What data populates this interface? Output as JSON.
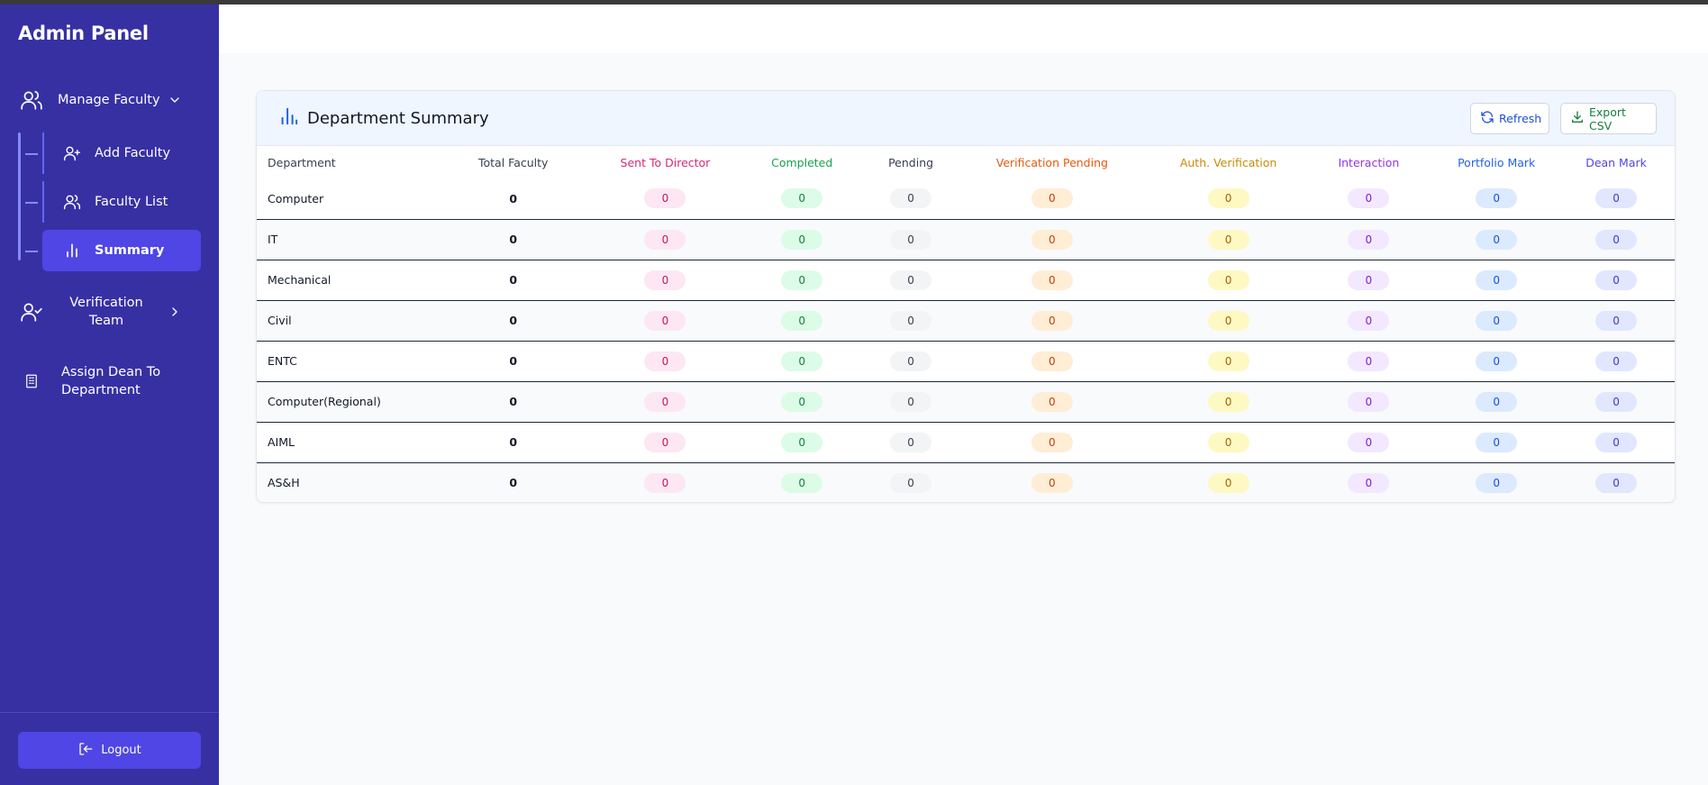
{
  "sidebar": {
    "brand": "Admin Panel",
    "manage_faculty": "Manage Faculty",
    "sub_items": [
      {
        "label": "Add Faculty"
      },
      {
        "label": "Faculty List"
      },
      {
        "label": "Summary"
      }
    ],
    "verification_team": "Verification Team",
    "assign_dean": "Assign Dean To Department",
    "logout": "Logout"
  },
  "summary": {
    "title": "Department Summary",
    "refresh_label": "Refresh",
    "export_label": "Export CSV",
    "columns": [
      "Department",
      "Total Faculty",
      "Sent To Director",
      "Completed",
      "Pending",
      "Verification Pending",
      "Auth. Verification",
      "Interaction",
      "Portfolio Mark",
      "Dean Mark"
    ],
    "rows": [
      {
        "department": "Computer",
        "total": "0",
        "sent": "0",
        "completed": "0",
        "pending": "0",
        "ver_pending": "0",
        "auth": "0",
        "interaction": "0",
        "portfolio": "0",
        "dean": "0"
      },
      {
        "department": "IT",
        "total": "0",
        "sent": "0",
        "completed": "0",
        "pending": "0",
        "ver_pending": "0",
        "auth": "0",
        "interaction": "0",
        "portfolio": "0",
        "dean": "0"
      },
      {
        "department": "Mechanical",
        "total": "0",
        "sent": "0",
        "completed": "0",
        "pending": "0",
        "ver_pending": "0",
        "auth": "0",
        "interaction": "0",
        "portfolio": "0",
        "dean": "0"
      },
      {
        "department": "Civil",
        "total": "0",
        "sent": "0",
        "completed": "0",
        "pending": "0",
        "ver_pending": "0",
        "auth": "0",
        "interaction": "0",
        "portfolio": "0",
        "dean": "0"
      },
      {
        "department": "ENTC",
        "total": "0",
        "sent": "0",
        "completed": "0",
        "pending": "0",
        "ver_pending": "0",
        "auth": "0",
        "interaction": "0",
        "portfolio": "0",
        "dean": "0"
      },
      {
        "department": "Computer(Regional)",
        "total": "0",
        "sent": "0",
        "completed": "0",
        "pending": "0",
        "ver_pending": "0",
        "auth": "0",
        "interaction": "0",
        "portfolio": "0",
        "dean": "0"
      },
      {
        "department": "AIML",
        "total": "0",
        "sent": "0",
        "completed": "0",
        "pending": "0",
        "ver_pending": "0",
        "auth": "0",
        "interaction": "0",
        "portfolio": "0",
        "dean": "0"
      },
      {
        "department": "AS&H",
        "total": "0",
        "sent": "0",
        "completed": "0",
        "pending": "0",
        "ver_pending": "0",
        "auth": "0",
        "interaction": "0",
        "portfolio": "0",
        "dean": "0"
      }
    ]
  },
  "colors": {
    "sidebar_bg": "#3730a3",
    "active_item": "#4f46e5",
    "sent_to_director": "#db2777",
    "completed": "#16a34a",
    "verification_pending": "#ea580c",
    "auth_verification": "#ca8a04",
    "interaction": "#9333ea",
    "portfolio_mark": "#2563eb",
    "dean_mark": "#4f46e5"
  }
}
